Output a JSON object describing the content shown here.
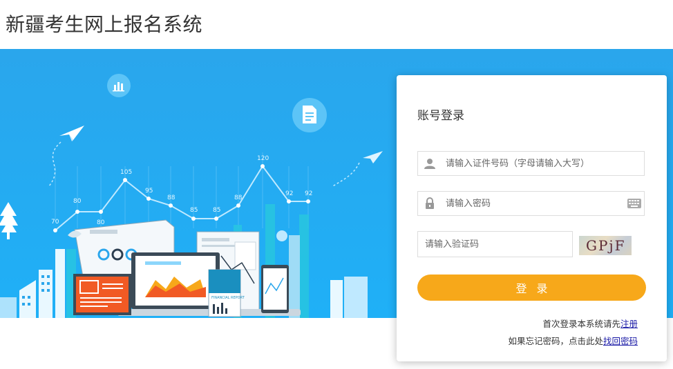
{
  "header": {
    "title": "新疆考生网上报名系统"
  },
  "hero": {
    "chart_labels": [
      "70",
      "80",
      "80",
      "105",
      "95",
      "88",
      "85",
      "85",
      "88",
      "120",
      "92",
      "92"
    ],
    "report_label": "FINANCIAL REPORT",
    "colors": {
      "sky": "#1fb0f7",
      "accent_orange": "#f15a24",
      "accent_yellow": "#f7a81a"
    }
  },
  "login": {
    "title": "账号登录",
    "id_placeholder": "请输入证件号码（字母请输入大写）",
    "password_placeholder": "请输入密码",
    "captcha_placeholder": "请输入验证码",
    "captcha_text": "GPjF",
    "button_label": "登录",
    "register_prompt": "首次登录本系统请先",
    "register_link": "注册",
    "forgot_prompt": "如果忘记密码，点击此处",
    "forgot_link": "找回密码",
    "icons": {
      "user": "user-icon",
      "lock": "lock-icon",
      "keyboard": "keyboard-icon"
    }
  }
}
